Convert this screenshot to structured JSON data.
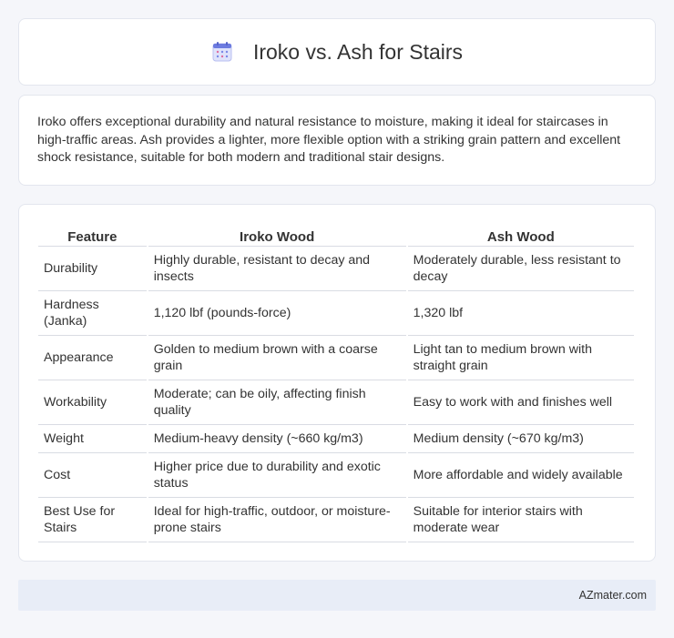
{
  "header": {
    "title": "Iroko vs. Ash for Stairs",
    "icon": "calendar-icon"
  },
  "intro": {
    "text": "Iroko offers exceptional durability and natural resistance to moisture, making it ideal for staircases in high-traffic areas. Ash provides a lighter, more flexible option with a striking grain pattern and excellent shock resistance, suitable for both modern and traditional stair designs."
  },
  "table": {
    "headers": [
      "Feature",
      "Iroko Wood",
      "Ash Wood"
    ],
    "rows": [
      [
        "Durability",
        "Highly durable, resistant to decay and insects",
        "Moderately durable, less resistant to decay"
      ],
      [
        "Hardness (Janka)",
        "1,120 lbf (pounds-force)",
        "1,320 lbf"
      ],
      [
        "Appearance",
        "Golden to medium brown with a coarse grain",
        "Light tan to medium brown with straight grain"
      ],
      [
        "Workability",
        "Moderate; can be oily, affecting finish quality",
        "Easy to work with and finishes well"
      ],
      [
        "Weight",
        "Medium-heavy density (~660 kg/m3)",
        "Medium density (~670 kg/m3)"
      ],
      [
        "Cost",
        "Higher price due to durability and exotic status",
        "More affordable and widely available"
      ],
      [
        "Best Use for Stairs",
        "Ideal for high-traffic, outdoor, or moisture-prone stairs",
        "Suitable for interior stairs with moderate wear"
      ]
    ]
  },
  "footer": {
    "brand": "AZmater.com"
  }
}
